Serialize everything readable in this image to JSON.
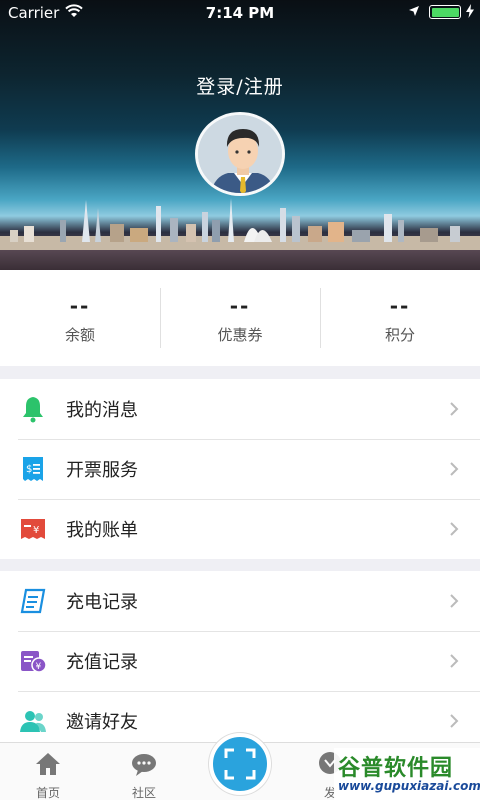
{
  "status_bar": {
    "carrier": "Carrier",
    "time": "7:14 PM"
  },
  "header": {
    "login_link": "登录/注册"
  },
  "stats": [
    {
      "value": "--",
      "label": "余额"
    },
    {
      "value": "--",
      "label": "优惠券"
    },
    {
      "value": "--",
      "label": "积分"
    }
  ],
  "menu_group_1": [
    {
      "label": "我的消息",
      "icon": "bell-icon",
      "color": "#2cc36b"
    },
    {
      "label": "开票服务",
      "icon": "invoice-icon",
      "color": "#1aa3e8"
    },
    {
      "label": "我的账单",
      "icon": "bill-icon",
      "color": "#e24a3b"
    }
  ],
  "menu_group_2": [
    {
      "label": "充电记录",
      "icon": "charge-record-icon",
      "color": "#1a8fe0"
    },
    {
      "label": "充值记录",
      "icon": "recharge-record-icon",
      "color": "#8a55c7"
    },
    {
      "label": "邀请好友",
      "icon": "invite-friends-icon",
      "color": "#2cc3b4"
    }
  ],
  "tabbar": {
    "home": "首页",
    "community": "社区",
    "discover": "发"
  },
  "watermark": {
    "title": "谷普软件园",
    "url": "www.gupuxiazai.com"
  },
  "colors": {
    "scan_button": "#2aa3dd",
    "battery": "#4cd964"
  }
}
